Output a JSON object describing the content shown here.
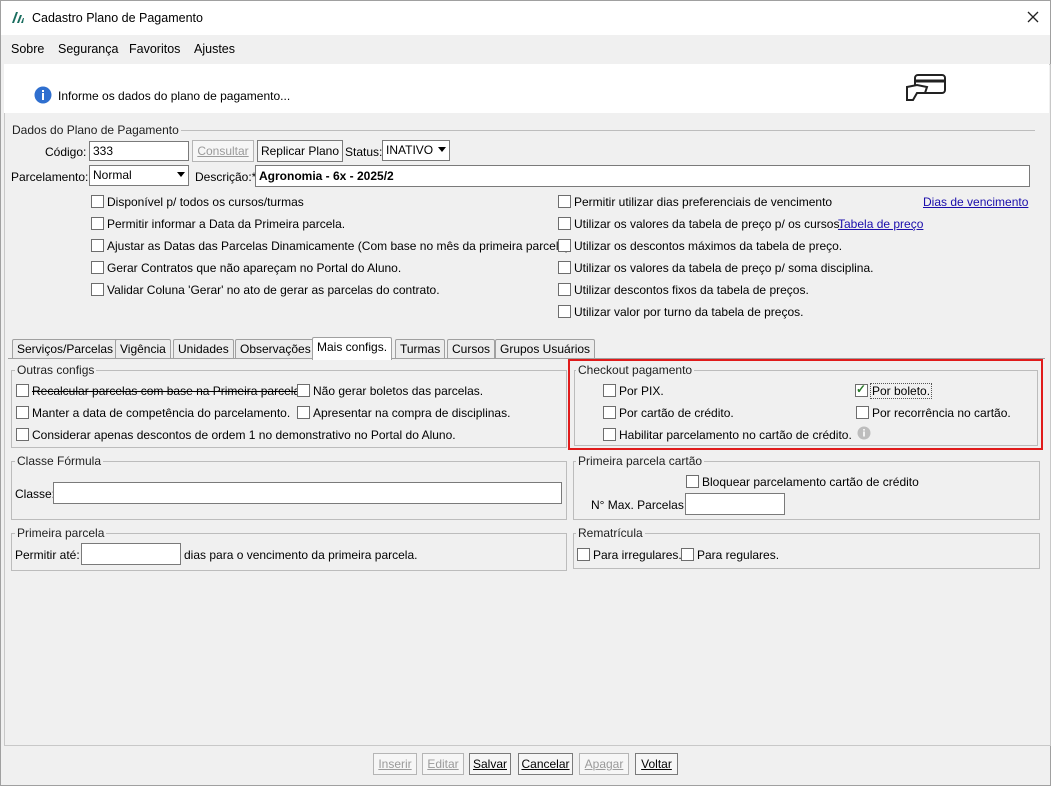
{
  "window": {
    "title": "Cadastro Plano de Pagamento"
  },
  "menu": {
    "sobre": "Sobre",
    "seguranca": "Segurança",
    "favoritos": "Favoritos",
    "ajustes": "Ajustes"
  },
  "info": {
    "text": "Informe os dados do plano de pagamento..."
  },
  "dados": {
    "group_title": "Dados do Plano de Pagamento",
    "codigo_label": "Código:",
    "codigo_value": "333",
    "consultar": "Consultar",
    "replicar": "Replicar Plano",
    "status_label": "Status:",
    "status_value": "INATIVO",
    "parcelamento_label": "Parcelamento:",
    "parcelamento_value": "Normal",
    "descricao_label": "Descrição:*",
    "descricao_value": "Agronomia - 6x - 2025/2",
    "left_options": [
      "Disponível p/ todos os cursos/turmas",
      "Permitir informar a Data da Primeira parcela.",
      "Ajustar as Datas das Parcelas Dinamicamente (Com base no mês da primeira parcela)",
      "Gerar Contratos que não apareçam no Portal do Aluno.",
      "Validar Coluna 'Gerar' no ato de gerar as parcelas do contrato."
    ],
    "right_options": [
      "Permitir utilizar dias preferenciais de vencimento",
      "Utilizar os valores da tabela de preço p/ os cursos.",
      "Utilizar os descontos máximos da tabela de preço.",
      "Utilizar os valores da tabela de preço p/ soma disciplina.",
      "Utilizar descontos fixos da tabela de preços.",
      "Utilizar valor por turno da tabela de preços."
    ],
    "dias_link": "Dias de vencimento",
    "tabela_link": "Tabela de preço"
  },
  "tabs": [
    "Serviços/Parcelas",
    "Vigência",
    "Unidades",
    "Observações",
    "Mais configs.",
    "Turmas",
    "Cursos",
    "Grupos Usuários"
  ],
  "outras": {
    "title": "Outras configs",
    "recalcular": "Recalcular parcelas com base na Primeira parcela.",
    "nao_gerar": "Não gerar boletos das parcelas.",
    "manter": "Manter a data de competência do parcelamento.",
    "apresentar": "Apresentar na compra de disciplinas.",
    "considerar": "Considerar apenas descontos de ordem 1 no demonstrativo no Portal do Aluno."
  },
  "checkout": {
    "title": "Checkout pagamento",
    "pix": "Por PIX.",
    "boleto": "Por boleto.",
    "cartao": "Por cartão de crédito.",
    "recorrencia": "Por recorrência no cartão.",
    "habilitar": "Habilitar parcelamento no cartão de crédito."
  },
  "classe": {
    "title": "Classe Fórmula",
    "label": "Classe:"
  },
  "primeira_cartao": {
    "title": "Primeira parcela cartão",
    "bloquear": "Bloquear parcelamento cartão de crédito",
    "max_label": "N° Max. Parcelas:"
  },
  "primeira": {
    "title": "Primeira parcela",
    "label": "Permitir até:",
    "suffix": "dias para o vencimento da primeira parcela."
  },
  "rematricula": {
    "title": "Rematrícula",
    "irregulares": "Para irregulares.",
    "regulares": "Para regulares."
  },
  "footer": {
    "inserir": "Inserir",
    "editar": "Editar",
    "salvar": "Salvar",
    "cancelar": "Cancelar",
    "apagar": "Apagar",
    "voltar": "Voltar"
  },
  "colors": {
    "highlight_border": "#e01b1b",
    "link": "#1a0dab"
  }
}
